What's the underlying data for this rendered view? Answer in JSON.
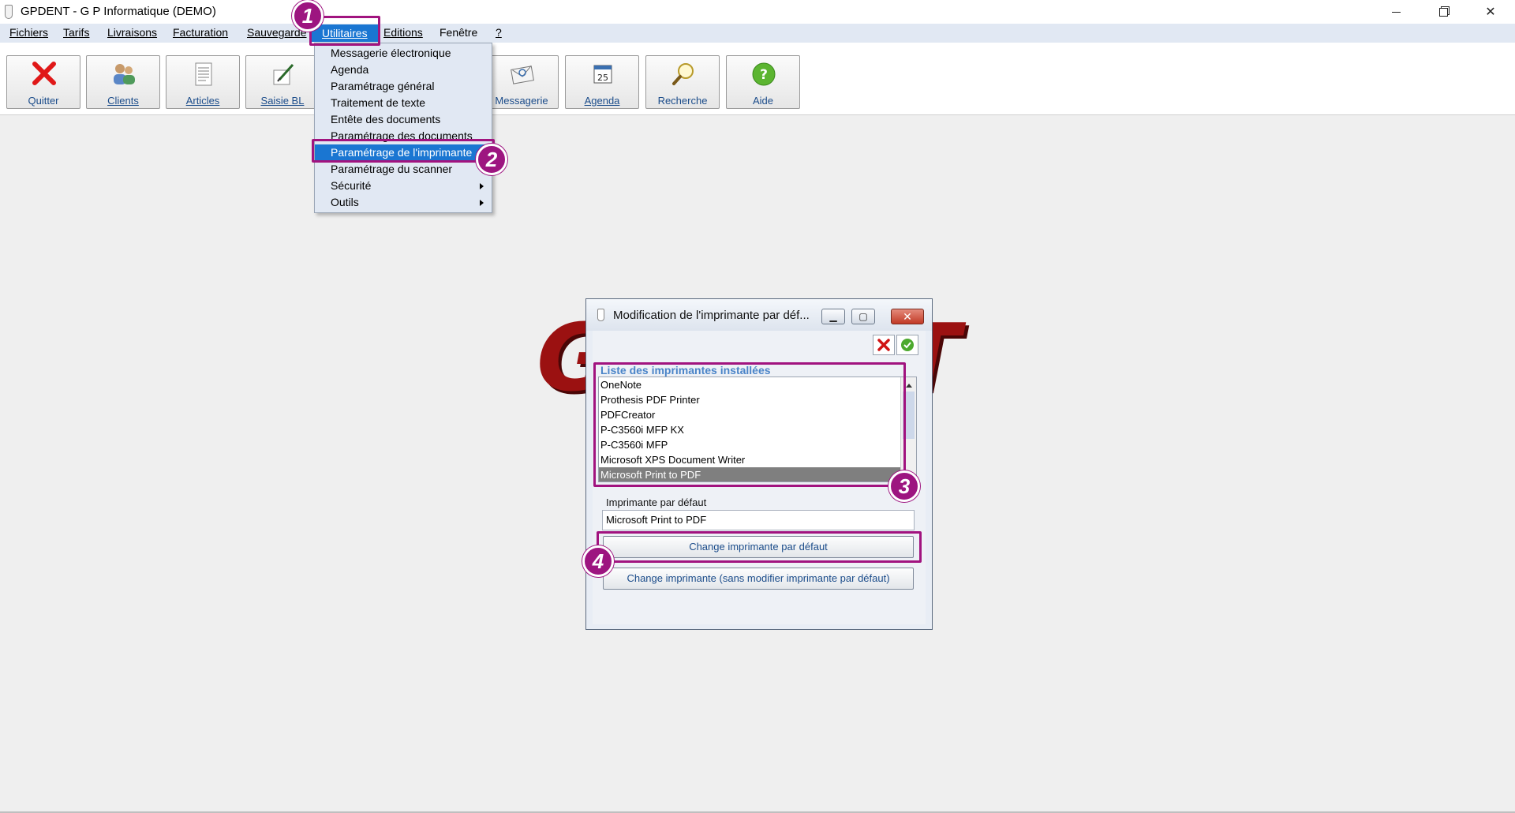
{
  "window": {
    "title": "GPDENT  -  G P Informatique  (DEMO)",
    "controls": {
      "minimize": "—",
      "maximize": "❐",
      "close": "✕"
    }
  },
  "menubar": {
    "items": [
      {
        "label": "Fichiers"
      },
      {
        "label": "Tarifs"
      },
      {
        "label": "Livraisons"
      },
      {
        "label": "Facturation"
      },
      {
        "label": "Sauvegarde"
      },
      {
        "label": "Utilitaires",
        "active": true
      },
      {
        "label": "Editions"
      },
      {
        "label": "Fenêtre"
      },
      {
        "label": "?"
      }
    ]
  },
  "toolbar": {
    "buttons": [
      {
        "label": "Quitter",
        "icon": "close-x-icon"
      },
      {
        "label": "Clients",
        "icon": "users-icon"
      },
      {
        "label": "Articles",
        "icon": "document-icon"
      },
      {
        "label": "Saisie BL",
        "icon": "pen-paper-icon"
      },
      {
        "label": "Messagerie",
        "icon": "envelope-icon"
      },
      {
        "label": "Agenda",
        "icon": "calendar-icon"
      },
      {
        "label": "Recherche",
        "icon": "magnifier-icon"
      },
      {
        "label": "Aide",
        "icon": "help-icon"
      }
    ],
    "calendar_day": "25"
  },
  "utilitaires_menu": {
    "items": [
      {
        "label": "Messagerie électronique"
      },
      {
        "label": "Agenda"
      },
      {
        "label": "Paramétrage général"
      },
      {
        "label": "Traitement de texte"
      },
      {
        "label": "Entête des documents"
      },
      {
        "label": "Paramétrage des documents"
      },
      {
        "label": "Paramétrage de l'imprimante",
        "selected": true
      },
      {
        "label": "Paramétrage du scanner"
      },
      {
        "label": "Sécurité",
        "submenu": true
      },
      {
        "label": "Outils",
        "submenu": true
      }
    ]
  },
  "background_logo": {
    "left": "G",
    "right": "T"
  },
  "annotations": {
    "badges": [
      "1",
      "2",
      "3",
      "4"
    ],
    "color": "#a1137f"
  },
  "dialog": {
    "title": "Modification de l'imprimante par déf...",
    "controls": {
      "minimize": "▁",
      "maximize": "▢",
      "close": "✕"
    },
    "printer_list": {
      "heading": "Liste des imprimantes installées",
      "items": [
        "OneNote",
        "Prothesis PDF Printer",
        "PDFCreator",
        "P-C3560i MFP KX",
        "P-C3560i MFP",
        "Microsoft XPS Document Writer",
        "Microsoft Print to PDF"
      ],
      "selected_index": 6
    },
    "default_printer": {
      "label": "Imprimante par défaut",
      "value": "Microsoft Print to PDF"
    },
    "buttons": {
      "change_default": "Change imprimante par défaut",
      "change_without_default": "Change imprimante (sans modifier imprimante par défaut)"
    }
  }
}
